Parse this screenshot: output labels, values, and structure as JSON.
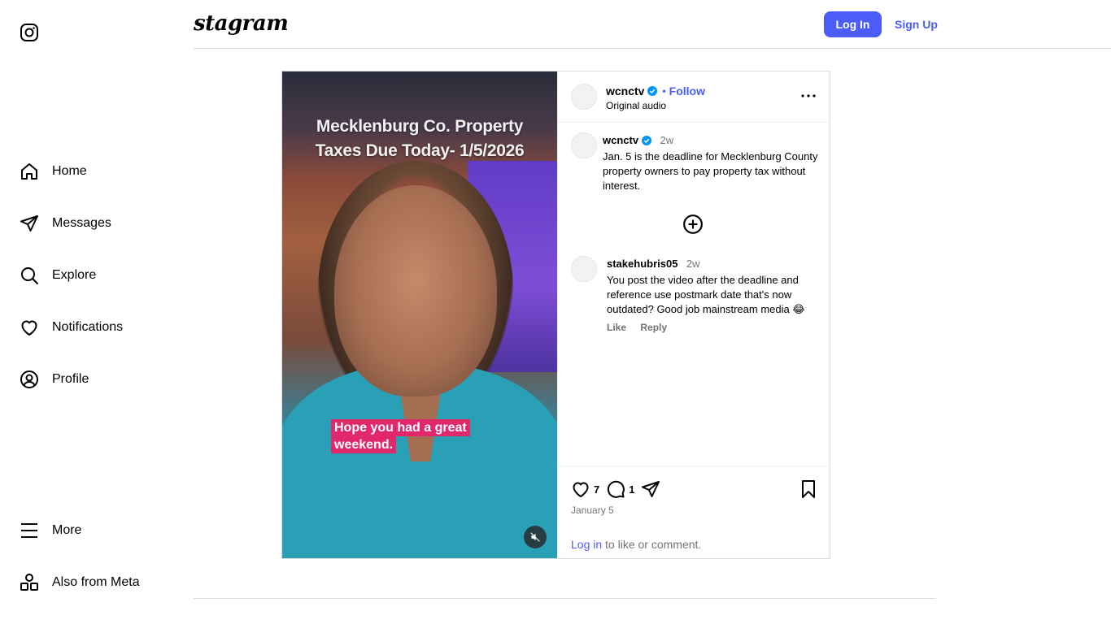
{
  "brand": {
    "wordmark": "stagram"
  },
  "sidebar": {
    "items": [
      {
        "label": "Home",
        "icon": "home-icon"
      },
      {
        "label": "Messages",
        "icon": "send-icon"
      },
      {
        "label": "Explore",
        "icon": "search-icon"
      },
      {
        "label": "Notifications",
        "icon": "heart-icon"
      },
      {
        "label": "Profile",
        "icon": "profile-icon"
      }
    ],
    "bottom_items": [
      {
        "label": "More",
        "icon": "menu-icon"
      },
      {
        "label": "Also from Meta",
        "icon": "apps-icon"
      }
    ]
  },
  "topbar": {
    "login_label": "Log In",
    "signup_label": "Sign Up"
  },
  "post": {
    "media": {
      "title_line1": "Mecklenburg Co. Property",
      "title_line2": "Taxes Due Today- 1/5/2026",
      "caption_line1": "Hope you had a great",
      "caption_line2": "weekend."
    },
    "header": {
      "username": "wcnctv",
      "separator": "•",
      "follow_label": "Follow",
      "audio": "Original audio"
    },
    "caption": {
      "username": "wcnctv",
      "time": "2w",
      "text": "Jan. 5 is the deadline for Mecklenburg County property owners to pay property tax without interest."
    },
    "comments": [
      {
        "username": "stakehubris05",
        "time": "2w",
        "text": "You post the video after the deadline and reference use postmark date that's now outdated? Good job mainstream media 😂",
        "like_label": "Like",
        "reply_label": "Reply"
      }
    ],
    "actions": {
      "likes": "7",
      "comments": "1"
    },
    "date": "January 5",
    "login_link": "Log in",
    "login_suffix": " to like or comment."
  },
  "colors": {
    "accent": "#4a5df9",
    "caption_bg": "#e0286b",
    "border": "#dbdbdb"
  }
}
